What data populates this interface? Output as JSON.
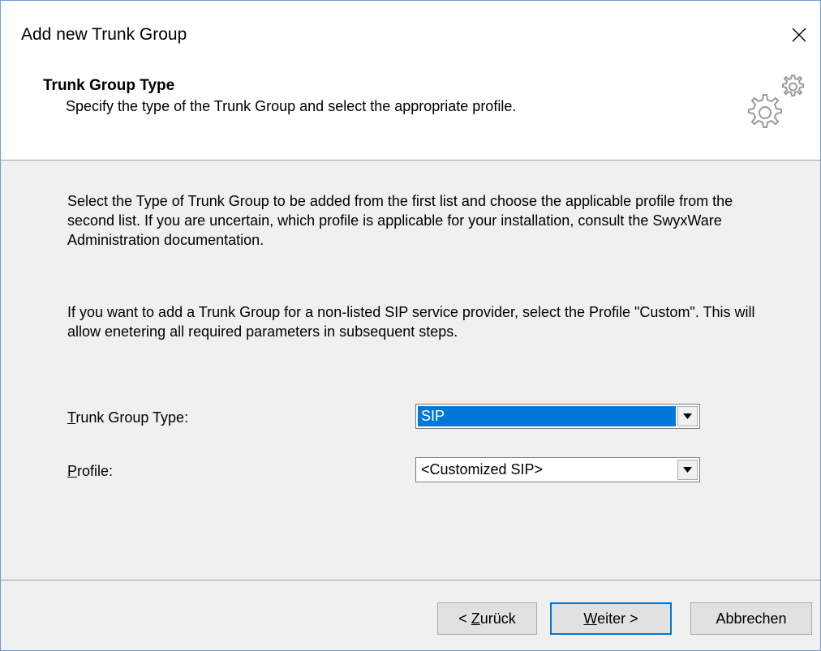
{
  "window": {
    "title": "Add new Trunk Group"
  },
  "header": {
    "title": "Trunk Group Type",
    "subtitle": "Specify the type of the Trunk Group and select the appropriate profile.",
    "icon": "gears-icon"
  },
  "content": {
    "paragraph1": "Select the Type of Trunk Group to be added from the first list and choose the applicable profile from the second list. If you are uncertain, which profile is applicable for your installation, consult the SwyxWare Administration documentation.",
    "paragraph2": "If you want to add a Trunk Group for a non-listed SIP service provider, select the Profile \"Custom\". This will allow enetering all required parameters in subsequent steps."
  },
  "fields": {
    "trunk_type": {
      "label_mnemonic": "T",
      "label_rest": "runk Group Type:",
      "value": "SIP"
    },
    "profile": {
      "label_mnemonic": "P",
      "label_rest": "rofile:",
      "value": "<Customized SIP>"
    }
  },
  "buttons": {
    "back_prefix": "< ",
    "back_mnemonic": "Z",
    "back_rest": "urück",
    "next_mnemonic": "W",
    "next_rest": "eiter >",
    "cancel": "Abbrechen"
  },
  "colors": {
    "selection": "#0078d7",
    "window_border": "#6f9fd0"
  }
}
